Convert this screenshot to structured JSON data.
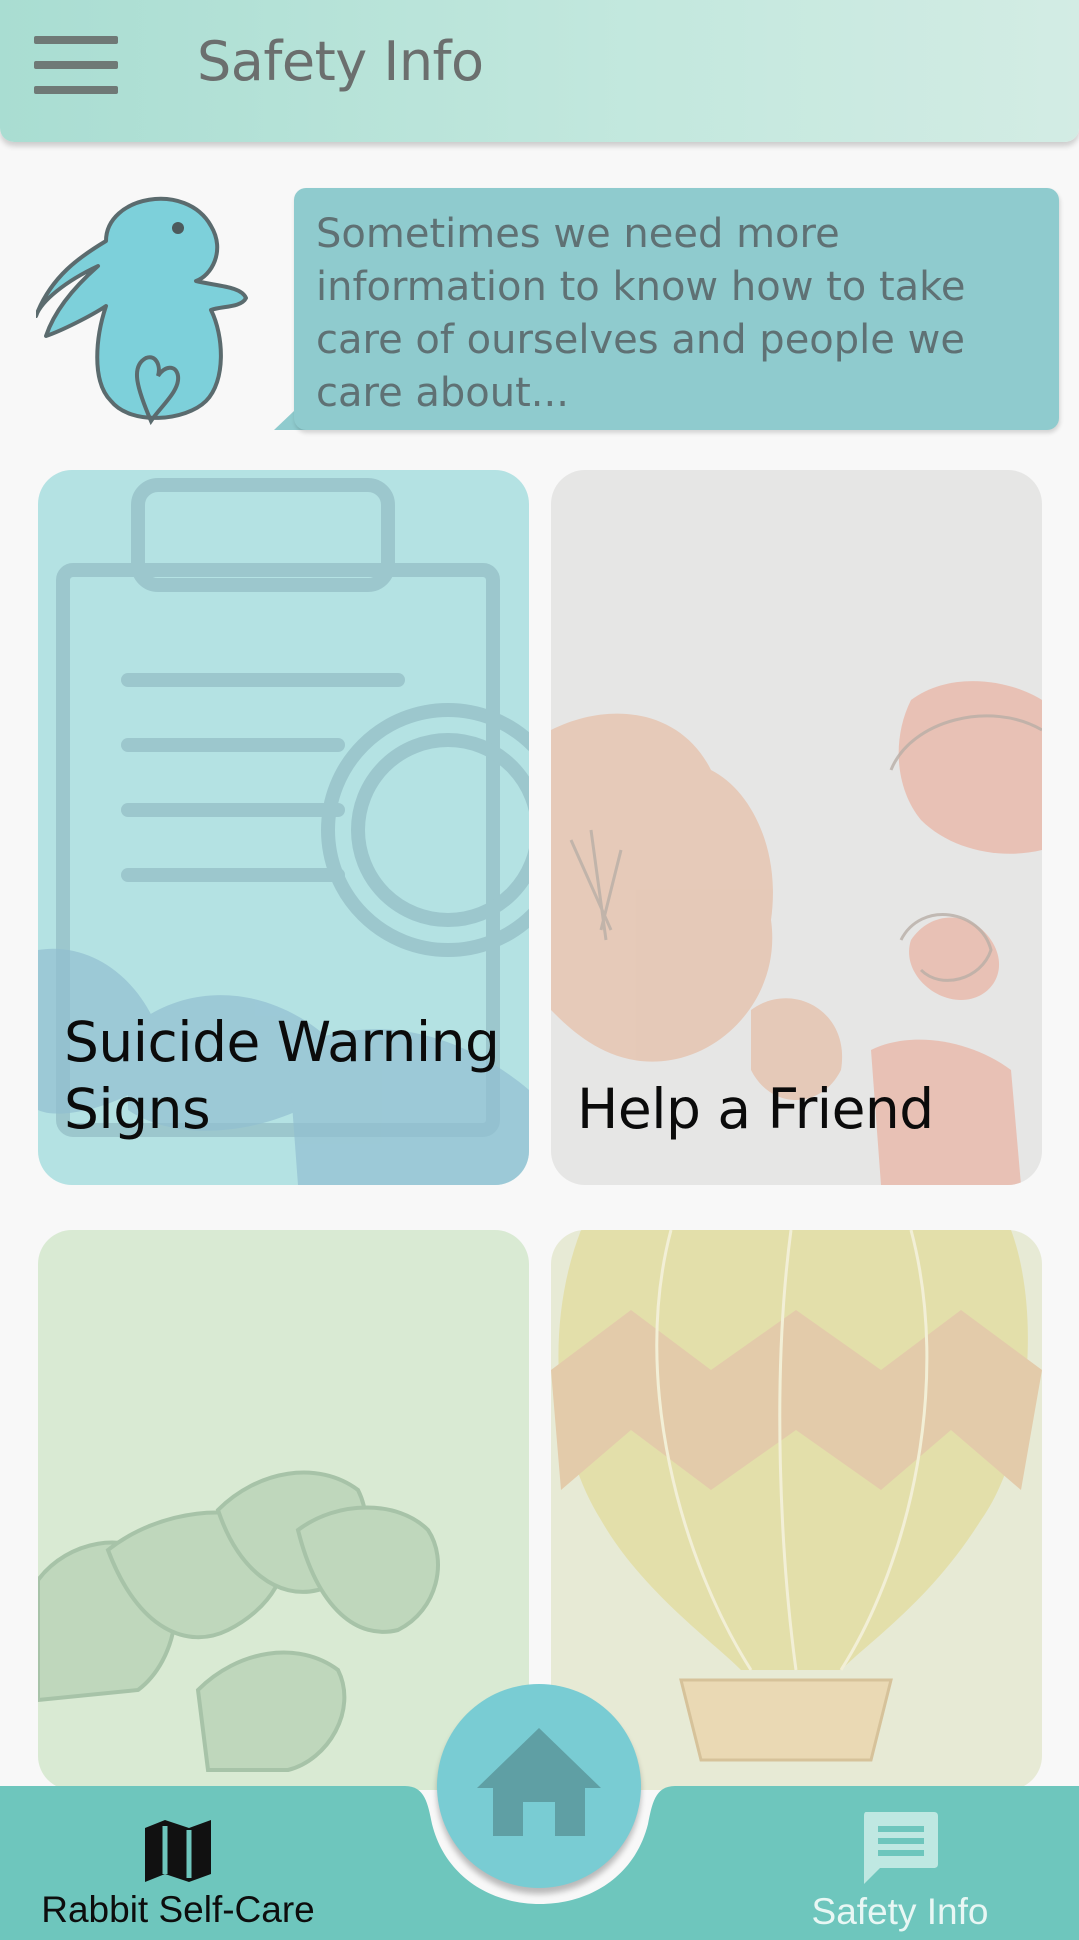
{
  "header": {
    "title": "Safety Info"
  },
  "intro": {
    "message": "Sometimes we need more information to know how to take care of ourselves and people we care about..."
  },
  "cards": [
    {
      "label": "Suicide Warning Signs"
    },
    {
      "label": "Help a Friend"
    },
    {
      "label": ""
    },
    {
      "label": ""
    }
  ],
  "bottom_nav": {
    "left_label": "Rabbit Self-Care",
    "right_label": "Safety Info"
  },
  "colors": {
    "header": "#bfe6dc",
    "bubble": "#8fcbce",
    "nav_bar": "#6ec6bd",
    "home_button": "#79ccd3",
    "active_label": "#e8f7f4"
  }
}
